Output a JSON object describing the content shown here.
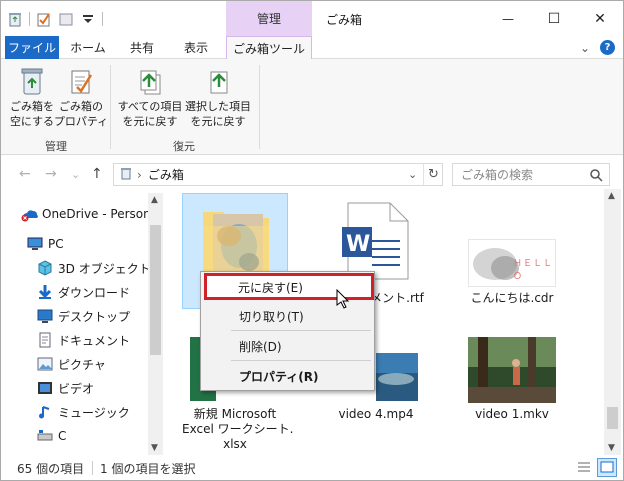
{
  "window": {
    "title": "ごみ箱",
    "context_tab_header": "管理",
    "minimize_glyph": "—",
    "maximize_glyph": "☐",
    "close_glyph": "✕"
  },
  "ribbon_tabs": {
    "file": "ファイル",
    "home": "ホーム",
    "share": "共有",
    "view": "表示",
    "recycle_tools": "ごみ箱ツール",
    "expand_glyph": "⌄",
    "help_glyph": "?"
  },
  "ribbon": {
    "empty_bin_label": "ごみ箱を\n空にする",
    "bin_properties_label": "ごみ箱の\nプロパティ",
    "restore_all_label": "すべての項目\nを元に戻す",
    "restore_selected_label": "選択した項目\nを元に戻す",
    "group_manage": "管理",
    "group_restore": "復元"
  },
  "address": {
    "back": "←",
    "forward": "→",
    "recent": "⌄",
    "up": "↑",
    "separator": "›",
    "path": "ごみ箱",
    "dropdown": "⌄",
    "refresh": "↻",
    "search_placeholder": "ごみ箱の検索"
  },
  "nav": {
    "items": [
      {
        "label": "OneDrive - Person",
        "icon": "onedrive-icon"
      },
      {
        "label": "PC",
        "icon": "pc-icon"
      },
      {
        "label": "3D オブジェクト",
        "icon": "3d-objects-icon"
      },
      {
        "label": "ダウンロード",
        "icon": "download-icon"
      },
      {
        "label": "デスクトップ",
        "icon": "desktop-icon"
      },
      {
        "label": "ドキュメント",
        "icon": "documents-icon"
      },
      {
        "label": "ピクチャ",
        "icon": "pictures-icon"
      },
      {
        "label": "ビデオ",
        "icon": "videos-icon"
      },
      {
        "label": "ミュージック",
        "icon": "music-icon"
      },
      {
        "label": "C",
        "icon": "drive-icon"
      }
    ]
  },
  "files": [
    {
      "name": "",
      "type": "folder"
    },
    {
      "name": "ュメント.rtf",
      "type": "word"
    },
    {
      "name": "こんにちは.cdr",
      "type": "cdr"
    },
    {
      "name": "新規 Microsoft\nExcel ワークシート.\nxlsx",
      "type": "excel"
    },
    {
      "name": "video 4.mp4",
      "type": "video"
    },
    {
      "name": "video 1.mkv",
      "type": "video"
    }
  ],
  "cdr_thumb_text": "ＨＥＬＬＯ",
  "context_menu": {
    "restore": "元に戻す(E)",
    "cut": "切り取り(T)",
    "delete": "削除(D)",
    "properties": "プロパティ(R)"
  },
  "status": {
    "item_count": "65 個の項目",
    "selected": "1 個の項目を選択"
  },
  "colors": {
    "accent": "#1c6ac8",
    "context_tab": "#e7d2f5",
    "highlight": "#d0202a",
    "selection": "#cce8ff"
  }
}
